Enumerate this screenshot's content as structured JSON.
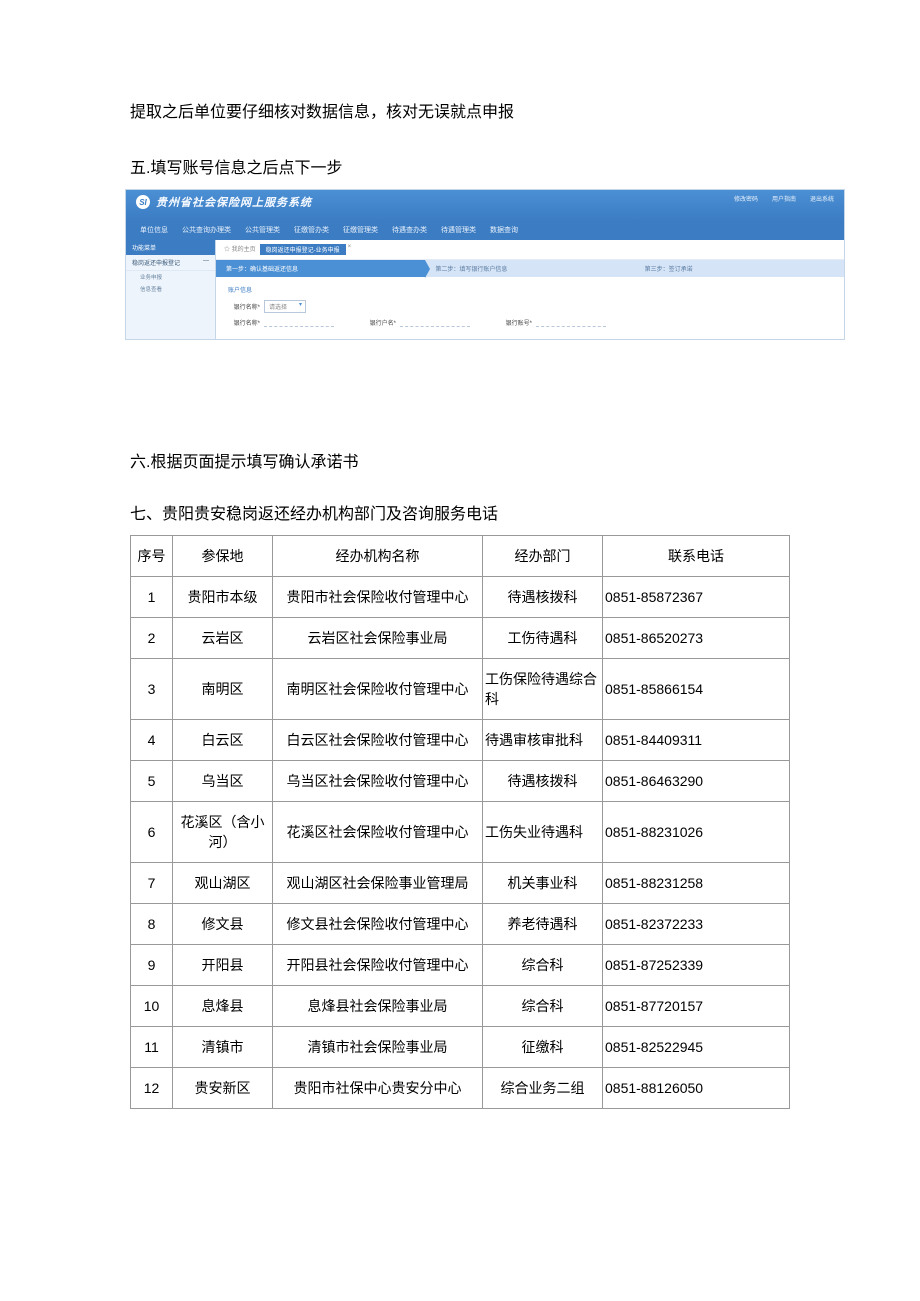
{
  "instruction_line1": "提取之后单位要仔细核对数据信息，核对无误就点申报",
  "section5_title": "五.填写账号信息之后点下一步",
  "section6_title": "六.根据页面提示填写确认承诺书",
  "section7_title": "七、贵阳贵安稳岗返还经办机构部门及咨询服务电话",
  "app": {
    "logo_text": "SI",
    "title": "贵州省社会保险网上服务系统",
    "header_links": [
      "修改密码",
      "用户指南",
      "退出系统"
    ],
    "nav": [
      "单位信息",
      "公共查询办理类",
      "公共管理类",
      "征缴管办类",
      "征缴管理类",
      "待遇查办类",
      "待遇管理类",
      "数据查询"
    ],
    "sidebar": {
      "header": "功能菜单",
      "item1": "稳岗返还申报登记",
      "item1_expand": "—",
      "sub1": "业务申报",
      "sub2": "信息查看"
    },
    "breadcrumb": {
      "home": "☆ 我的主页",
      "active": "稳岗返还申报登记-业务申报",
      "close": "×"
    },
    "steps": [
      "第一步：确认基础返还信息",
      "第二步：填写银行账户信息",
      "第三步：签订承诺"
    ],
    "form": {
      "section_title": "账户信息",
      "bank_name_label": "银行名称*",
      "bank_name_placeholder": "请选择",
      "acct_name_label": "银行名称*",
      "acct_no_label": "银行户名*",
      "acct_num_label": "银行账号*"
    }
  },
  "table": {
    "headers": [
      "序号",
      "参保地",
      "经办机构名称",
      "经办部门",
      "联系电话"
    ],
    "rows": [
      {
        "seq": "1",
        "loc": "贵阳市本级",
        "org": "贵阳市社会保险收付管理中心",
        "dept": "待遇核拨科",
        "phone": "0851-85872367"
      },
      {
        "seq": "2",
        "loc": "云岩区",
        "org": "云岩区社会保险事业局",
        "dept": "工伤待遇科",
        "phone": "0851-86520273"
      },
      {
        "seq": "3",
        "loc": "南明区",
        "org": "南明区社会保险收付管理中心",
        "dept": "工伤保险待遇综合科",
        "phone": "0851-85866154",
        "dept_special": true
      },
      {
        "seq": "4",
        "loc": "白云区",
        "org": "白云区社会保险收付管理中心",
        "dept": "待遇审核审批科",
        "phone": "0851-84409311",
        "dept_left": true
      },
      {
        "seq": "5",
        "loc": "乌当区",
        "org": "乌当区社会保险收付管理中心",
        "dept": "待遇核拨科",
        "phone": "0851-86463290"
      },
      {
        "seq": "6",
        "loc": "花溪区（含小河）",
        "org": "花溪区社会保险收付管理中心",
        "dept": "工伤失业待遇科",
        "phone": "0851-88231026",
        "dept_left": true
      },
      {
        "seq": "7",
        "loc": "观山湖区",
        "org": "观山湖区社会保险事业管理局",
        "dept": "机关事业科",
        "phone": "0851-88231258"
      },
      {
        "seq": "8",
        "loc": "修文县",
        "org": "修文县社会保险收付管理中心",
        "dept": "养老待遇科",
        "phone": "0851-82372233"
      },
      {
        "seq": "9",
        "loc": "开阳县",
        "org": "开阳县社会保险收付管理中心",
        "dept": "综合科",
        "phone": "0851-87252339"
      },
      {
        "seq": "10",
        "loc": "息烽县",
        "org": "息烽县社会保险事业局",
        "dept": "综合科",
        "phone": "0851-87720157"
      },
      {
        "seq": "11",
        "loc": "清镇市",
        "org": "清镇市社会保险事业局",
        "dept": "征缴科",
        "phone": "0851-82522945"
      },
      {
        "seq": "12",
        "loc": "贵安新区",
        "org": "贵阳市社保中心贵安分中心",
        "dept": "综合业务二组",
        "phone": "0851-88126050"
      }
    ]
  }
}
